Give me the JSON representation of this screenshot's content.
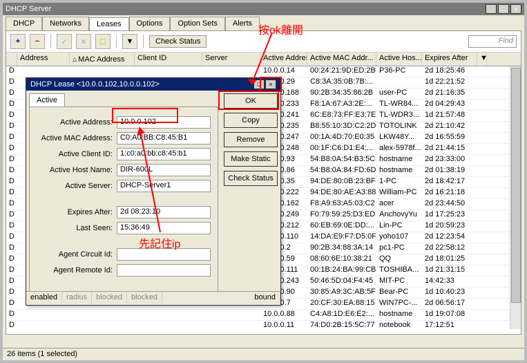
{
  "window": {
    "title": "DHCP Server"
  },
  "tabs": [
    "DHCP",
    "Networks",
    "Leases",
    "Options",
    "Option Sets",
    "Alerts"
  ],
  "active_tab_index": 2,
  "toolbar": {
    "add_icon": "+",
    "remove_icon": "−",
    "check_label": "Check Status",
    "find_placeholder": "Find"
  },
  "grid_headers": {
    "d": "",
    "addr": "Address",
    "mac": "MAC Address",
    "cid": "Client ID",
    "srv": "Server",
    "aaddr": "Active Address",
    "amac": "Active MAC Addr...",
    "ahost": "Active Hos...",
    "exp": "Expires After",
    "end": "▼"
  },
  "grid_rows": [
    {
      "d": "D",
      "aaddr": "10.0.0.14",
      "amac": "00:24:21:9D:ED:2B",
      "ahost": "P36-PC",
      "exp": "2d 18:25:46"
    },
    {
      "d": "D",
      "aaddr": "10.0.0.29",
      "amac": "C8:3A:35:0B:7B:...",
      "ahost": "",
      "exp": "1d 22:21:52"
    },
    {
      "d": "D",
      "aaddr": "10.0.0.168",
      "amac": "90:2B:34:35:86:2B",
      "ahost": "user-PC",
      "exp": "2d 21:16:35"
    },
    {
      "d": "D",
      "aaddr": "10.0.0.233",
      "amac": "F8:1A:67:A3:2E:...",
      "ahost": "TL-WR84...",
      "exp": "2d 04:29:43"
    },
    {
      "d": "D",
      "aaddr": "10.0.0.241",
      "amac": "6C:E8:73:FF:E3:7E",
      "ahost": "TL-WDR3...",
      "exp": "1d 21:57:48"
    },
    {
      "d": "D",
      "aaddr": "10.0.0.235",
      "amac": "B8:55:10:3D:C2:2D",
      "ahost": "TOTOLINK",
      "exp": "2d 21:10:42"
    },
    {
      "d": "D",
      "aaddr": "10.0.0.247",
      "amac": "00:1A:4D:70:E0:35",
      "ahost": "LKW48Y...",
      "exp": "2d 16:55:59"
    },
    {
      "d": "D",
      "aaddr": "10.0.0.248",
      "amac": "00:1F:C6:D1:E4:...",
      "ahost": "alex-5978f...",
      "exp": "2d 21:44:15"
    },
    {
      "d": "D",
      "aaddr": "10.0.0.93",
      "amac": "54:B8:0A:54:B3:5C",
      "ahost": "hostname",
      "exp": "2d 23:33:00"
    },
    {
      "d": "D",
      "aaddr": "10.0.0.86",
      "amac": "54:B8:0A:84:FD:6D",
      "ahost": "hostname",
      "exp": "2d 01:38:19"
    },
    {
      "d": "D",
      "aaddr": "10.0.0.35",
      "amac": "94:DE:80:0B:23:BF",
      "ahost": "1-PC",
      "exp": "2d 18:42:17"
    },
    {
      "d": "D",
      "aaddr": "10.0.0.222",
      "amac": "94:DE:80:AE:A3:88",
      "ahost": "William-PC",
      "exp": "2d 16:21:18"
    },
    {
      "d": "D",
      "aaddr": "10.0.0.162",
      "amac": "F8:A9:63:A5:03:C2",
      "ahost": "acer",
      "exp": "2d 23:44:50"
    },
    {
      "d": "D",
      "aaddr": "10.0.0.249",
      "amac": "F0:79:59:25:D3:ED",
      "ahost": "AnchovyYu",
      "exp": "1d 17:25:23"
    },
    {
      "d": "D",
      "aaddr": "10.0.0.212",
      "amac": "60:EB:69:0E:DD:...",
      "ahost": "Lin-PC",
      "exp": "1d 20:59:23"
    },
    {
      "d": "D",
      "aaddr": "10.0.0.110",
      "amac": "14:DA:E9:F7:D5:0F",
      "ahost": "yoho107",
      "exp": "2d 12:23:54"
    },
    {
      "d": "D",
      "aaddr": "10.0.0.2",
      "amac": "90:2B:34:88:3A:14",
      "ahost": "pc1-PC",
      "exp": "2d 22:58:12"
    },
    {
      "d": "D",
      "aaddr": "10.0.0.59",
      "amac": "08:60:6E:10:38:21",
      "ahost": "QQ",
      "exp": "2d 18:01:25"
    },
    {
      "d": "D",
      "aaddr": "10.0.0.111",
      "amac": "00:1B:24:BA:99:CB",
      "ahost": "TOSHIBA...",
      "exp": "1d 21:31:15"
    },
    {
      "d": "D",
      "aaddr": "10.0.0.243",
      "amac": "50:46:5D:04:F4:45",
      "ahost": "MIT-PC",
      "exp": "14:42:33"
    },
    {
      "d": "D",
      "aaddr": "10.0.0.90",
      "amac": "30:85:A9:3C:AB:5F",
      "ahost": "Bear-PC",
      "exp": "1d 10:40:23"
    },
    {
      "d": "D",
      "aaddr": "10.0.0.7",
      "amac": "20:CF:30:EA:88:15",
      "ahost": "WIN7PC-...",
      "exp": "2d 06:56:17"
    },
    {
      "d": "D",
      "aaddr": "10.0.0.88",
      "amac": "C4:A8:1D:E6:E2:...",
      "ahost": "hostname",
      "exp": "1d 19:07:08"
    },
    {
      "d": "D",
      "aaddr": "10.0.0.11",
      "amac": "74:D0:2B:15:5C:77",
      "ahost": "notebook",
      "exp": "17:12:51"
    }
  ],
  "dialog": {
    "title": "DHCP Lease <10.0.0.102,10.0.0.102>",
    "tab": "Active",
    "fields": {
      "active_address": {
        "label": "Active Address:",
        "value": "10.0.0.102"
      },
      "active_mac": {
        "label": "Active MAC Address:",
        "value": "C0:A0:BB:C8:45:B1"
      },
      "active_client_id": {
        "label": "Active Client ID:",
        "value": "1:c0:a0:bb:c8:45:b1"
      },
      "active_host": {
        "label": "Active Host Name:",
        "value": "DIR-600L"
      },
      "active_server": {
        "label": "Active Server:",
        "value": "DHCP-Server1"
      },
      "expires_after": {
        "label": "Expires After:",
        "value": "2d 08:23:10"
      },
      "last_seen": {
        "label": "Last Seen:",
        "value": "15:36:49"
      },
      "agent_circuit": {
        "label": "Agent Circuit Id:",
        "value": ""
      },
      "agent_remote": {
        "label": "Agent Remote Id:",
        "value": ""
      }
    },
    "buttons": {
      "ok": "OK",
      "copy": "Copy",
      "remove": "Remove",
      "make_static": "Make Static",
      "check_status": "Check Status"
    },
    "status": {
      "enabled": "enabled",
      "radius": "radius",
      "blocked1": "blocked",
      "blocked2": "blocked",
      "bound": "bound"
    }
  },
  "status_bar": "26 items (1 selected)",
  "annotations": {
    "press_ok": "按ok離開",
    "remember_ip": "先記住ip"
  },
  "colors": {
    "red": "#ff0000",
    "titlebar_blue": "#0a246a"
  }
}
